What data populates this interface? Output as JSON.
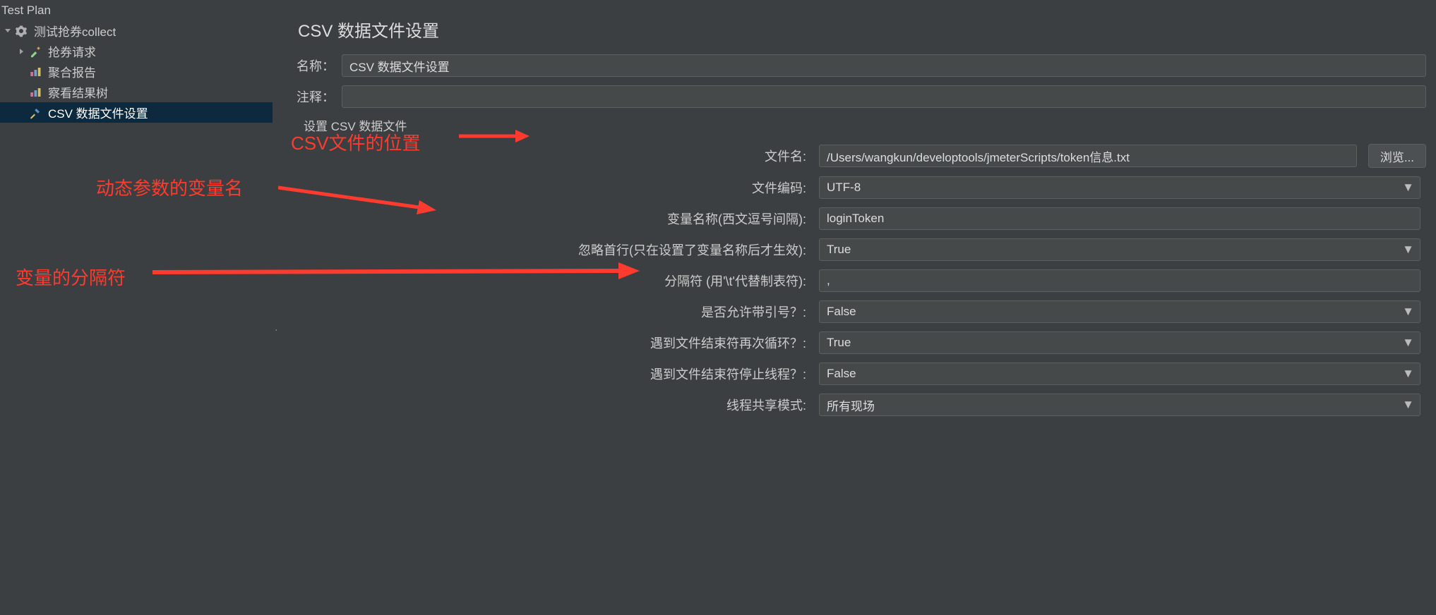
{
  "tree": {
    "root": "Test Plan",
    "items": [
      {
        "label": "测试抢券collect",
        "icon": "gear"
      },
      {
        "label": "抢券请求",
        "icon": "dropper",
        "expandable": true
      },
      {
        "label": "聚合报告",
        "icon": "chart"
      },
      {
        "label": "察看结果树",
        "icon": "chart"
      },
      {
        "label": "CSV 数据文件设置",
        "icon": "tools",
        "selected": true
      }
    ]
  },
  "panel": {
    "title": "CSV 数据文件设置",
    "name_label": "名称：",
    "name_value": "CSV 数据文件设置",
    "comment_label": "注释：",
    "comment_value": "",
    "fieldset_label": "设置 CSV 数据文件"
  },
  "fields": {
    "filename_label": "文件名:",
    "filename_value": "/Users/wangkun/developtools/jmeterScripts/token信息.txt",
    "browse_label": "浏览...",
    "encoding_label": "文件编码:",
    "encoding_value": "UTF-8",
    "varnames_label": "变量名称(西文逗号间隔):",
    "varnames_value": "loginToken",
    "ignorefirst_label": "忽略首行(只在设置了变量名称后才生效):",
    "ignorefirst_value": "True",
    "delimiter_label": "分隔符 (用'\\t'代替制表符):",
    "delimiter_value": ",",
    "quoted_label": "是否允许带引号？:",
    "quoted_value": "False",
    "recycle_label": "遇到文件结束符再次循环？:",
    "recycle_value": "True",
    "stop_label": "遇到文件结束符停止线程？:",
    "stop_value": "False",
    "sharing_label": "线程共享模式:",
    "sharing_value": "所有现场"
  },
  "annotations": {
    "a1": "CSV文件的位置",
    "a2": "动态参数的变量名",
    "a3": "变量的分隔符"
  }
}
